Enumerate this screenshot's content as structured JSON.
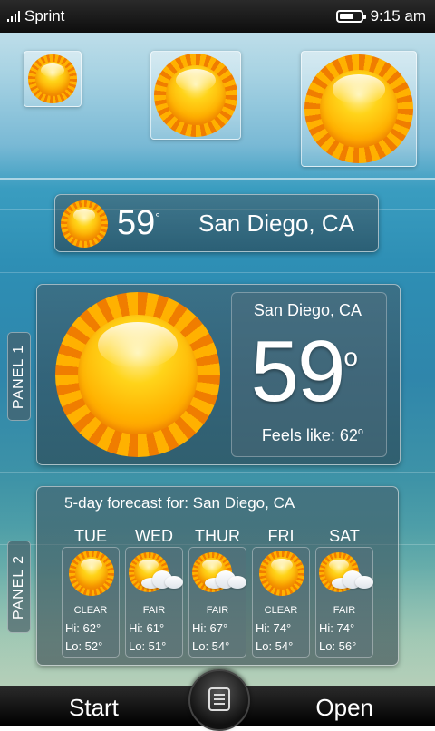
{
  "status_bar": {
    "carrier": "Sprint",
    "time": "9:15 am",
    "battery_level": 0.7,
    "signal_bars": 4
  },
  "icon_tiles": [
    {
      "icon": "sun-icon",
      "size": "small"
    },
    {
      "icon": "sun-icon",
      "size": "medium"
    },
    {
      "icon": "sun-icon",
      "size": "large"
    }
  ],
  "compact_widget": {
    "icon": "sun-icon",
    "temperature": "59",
    "degree": "°",
    "location": "San Diego, CA"
  },
  "panel1": {
    "side_label": "PANEL 1",
    "icon": "sun-icon",
    "location": "San Diego, CA",
    "temperature": "59",
    "degree": "o",
    "feels_like": "Feels like: 62",
    "feels_degree": "o"
  },
  "panel2": {
    "side_label": "PANEL 2",
    "title": "5-day forecast for:  San Diego, CA",
    "days": [
      {
        "day": "TUE",
        "icon": "sun-icon",
        "condition": "CLEAR",
        "hi": "Hi: 62°",
        "lo": "Lo: 52°"
      },
      {
        "day": "WED",
        "icon": "partly-cloudy-icon",
        "condition": "FAIR",
        "hi": "Hi: 61°",
        "lo": "Lo: 51°"
      },
      {
        "day": "THUR",
        "icon": "partly-cloudy-icon",
        "condition": "FAIR",
        "hi": "Hi: 67°",
        "lo": "Lo: 54°"
      },
      {
        "day": "FRI",
        "icon": "sun-icon",
        "condition": "CLEAR",
        "hi": "Hi: 74°",
        "lo": "Lo: 54°"
      },
      {
        "day": "SAT",
        "icon": "partly-cloudy-icon",
        "condition": "FAIR",
        "hi": "Hi: 74°",
        "lo": "Lo: 56°"
      }
    ]
  },
  "bottom_bar": {
    "left_softkey": "Start",
    "right_softkey": "Open",
    "menu_icon": "menu-icon"
  },
  "colors": {
    "sun_orange": "#f07d00",
    "sun_yellow": "#ffd41a",
    "glass": "#465a64"
  }
}
